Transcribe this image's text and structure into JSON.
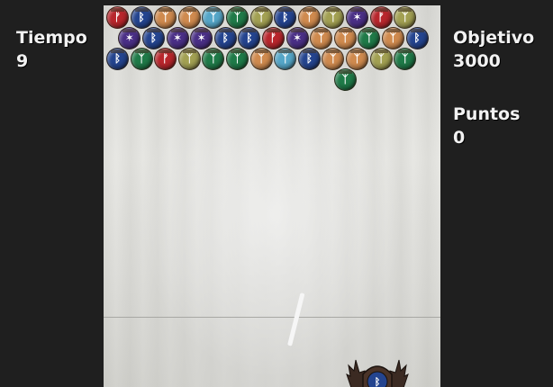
{
  "hud": {
    "time_label": "Tiempo",
    "time_value": "9",
    "goal_label": "Objetivo",
    "goal_value": "3000",
    "score_label": "Puntos",
    "score_value": "0"
  },
  "colors": {
    "red": "#b8262c",
    "blue": "#24448f",
    "purple": "#4a2f86",
    "orange": "#cf8a4e",
    "lightblue": "#55a6c8",
    "green": "#1f7a48",
    "olive": "#a2a052"
  },
  "symbols": {
    "red": "ᚠ",
    "blue": "ᛒ",
    "purple": "✶",
    "orange": "ᛉ",
    "lightblue": "ᛉ",
    "green": "ᛉ",
    "olive": "ᛉ"
  },
  "board": {
    "rows": [
      [
        "red",
        "blue",
        "orange",
        "orange",
        "lightblue",
        "green",
        "olive",
        "blue",
        "orange",
        "olive",
        "purple",
        "red",
        "olive"
      ],
      [
        "purple",
        "blue",
        "purple",
        "purple",
        "blue",
        "blue",
        "red",
        "purple",
        "orange",
        "orange",
        "green",
        "orange",
        "blue"
      ],
      [
        "blue",
        "green",
        "red",
        "olive",
        "green",
        "green",
        "orange",
        "lightblue",
        "blue",
        "orange",
        "orange",
        "olive",
        "green"
      ],
      [
        null,
        null,
        null,
        null,
        null,
        null,
        null,
        null,
        null,
        "green",
        null,
        null,
        null
      ]
    ]
  },
  "launcher": {
    "current_bubble": "blue"
  }
}
